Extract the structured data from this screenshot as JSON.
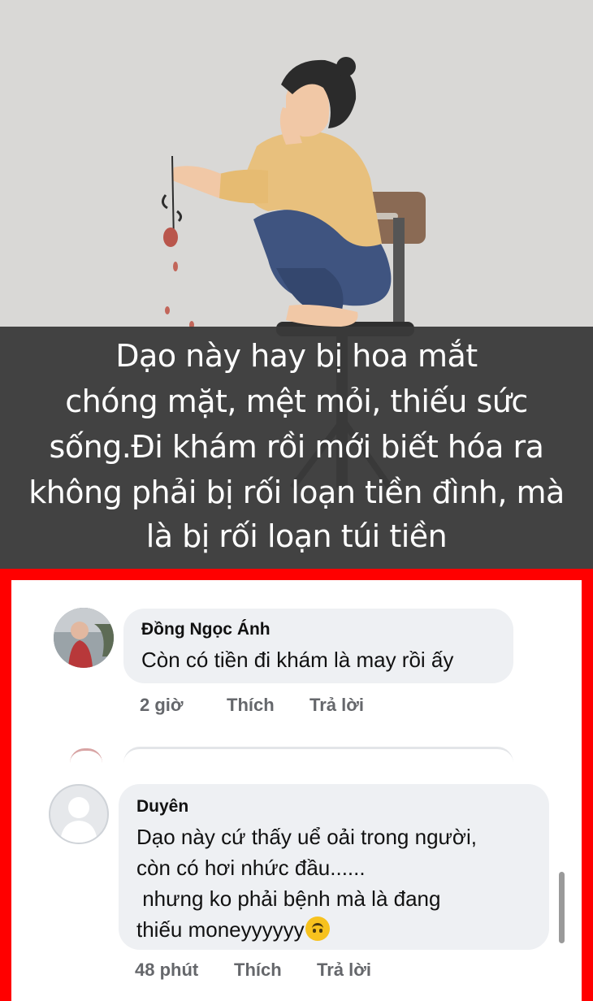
{
  "meme": {
    "caption_lines": [
      "Dạo này hay bị hoa mắt",
      "chóng mặt, mệt mỏi, thiếu sức",
      "sống.Đi khám rồi mới biết hóa ra",
      "không phải bị rối loạn tiền đình, mà",
      "là bị rối loạn túi tiền"
    ]
  },
  "comments": [
    {
      "author": "Đồng Ngọc Ánh",
      "text_lines": [
        "Còn có tiền đi khám là may rồi ấy"
      ],
      "time": "2 giờ",
      "like_label": "Thích",
      "reply_label": "Trả lời"
    },
    {
      "author": "Duyên",
      "text_lines": [
        "Dạo này cứ thấy uể oải trong người,",
        "còn có hơi nhức đầu......",
        " nhưng ko phải bệnh mà là đang",
        "thiếu moneyyyyyy"
      ],
      "emoji": "upside-down-face",
      "time": "48 phút",
      "like_label": "Thích",
      "reply_label": "Trả lời"
    }
  ],
  "colors": {
    "frame": "#ff0000",
    "bubble": "#eef0f3",
    "caption_bg": "#3a3a3a",
    "meme_bg": "#d9d8d6"
  }
}
